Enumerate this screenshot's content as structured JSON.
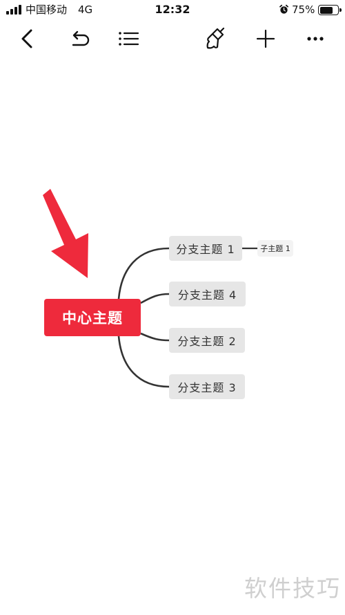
{
  "status_bar": {
    "carrier": "中国移动",
    "network": "4G",
    "time": "12:32",
    "battery_percent": "75%",
    "battery_level": 0.75
  },
  "toolbar": {
    "icons": [
      "back-icon",
      "undo-icon",
      "outline-list-icon",
      "style-brush-icon",
      "add-icon",
      "more-icon"
    ]
  },
  "mindmap": {
    "central_topic": "中心主题",
    "central_color": "#ee2a3c",
    "branches": [
      {
        "label": "分支主题 1",
        "subtopics": [
          "子主题 1"
        ]
      },
      {
        "label": "分支主题 4",
        "subtopics": []
      },
      {
        "label": "分支主题 2",
        "subtopics": []
      },
      {
        "label": "分支主题 3",
        "subtopics": []
      }
    ],
    "connector_color": "#333333",
    "branch_fill": "#e6e6e6"
  },
  "annotation": {
    "arrow_color": "#ee2a3c"
  },
  "watermark": "软件技巧"
}
